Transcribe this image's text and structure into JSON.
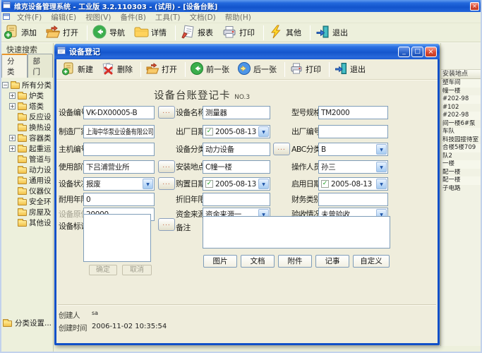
{
  "app": {
    "title": "维克设备管理系统 - 工业版 3.2.110303 - (试用) - [设备台账]",
    "menu_items": [
      "文件(F)",
      "编辑(E)",
      "视图(V)",
      "备件(B)",
      "工具(T)",
      "文档(D)",
      "帮助(H)"
    ],
    "toolbar": {
      "add": "添加",
      "open": "打开",
      "navigate": "导航",
      "details": "详情",
      "report": "报表",
      "print": "打印",
      "other": "其他",
      "exit": "退出"
    }
  },
  "sidebar": {
    "quick_search": "快速搜索",
    "tab_category": "分类",
    "tab_department": "部门",
    "tree": [
      {
        "label": "所有分类"
      },
      {
        "label": "炉类"
      },
      {
        "label": "塔类"
      },
      {
        "label": "反应设"
      },
      {
        "label": "换热设"
      },
      {
        "label": "容器类"
      },
      {
        "label": "起重运"
      },
      {
        "label": "管道与"
      },
      {
        "label": "动力设"
      },
      {
        "label": "通用设"
      },
      {
        "label": "仪器仪"
      },
      {
        "label": "安全环"
      },
      {
        "label": "房屋及"
      },
      {
        "label": "其他设"
      }
    ],
    "footer": "分类设置..."
  },
  "back_table": {
    "header": "安装地点",
    "rows": [
      "塑车间",
      "幢一楼",
      "#202-98",
      "#102",
      "#202-98",
      "间一楼6#泵",
      "车队",
      "科技园接待室",
      "合楼5楼709",
      "队2",
      "一楼",
      "配一楼",
      "配一楼",
      "子电路"
    ]
  },
  "dialog": {
    "title": "设备登记",
    "toolbar": {
      "new": "新建",
      "delete": "删除",
      "open": "打开",
      "prev": "前一张",
      "next": "后一张",
      "print": "打印",
      "exit": "退出"
    },
    "card_title": "设备台账登记卡",
    "card_no": "NO.3",
    "browse": "...",
    "fields": {
      "device_no": {
        "label": "设备编号",
        "value": "VK-DX00005-B"
      },
      "device_name": {
        "label": "设备名称",
        "value": "测量器"
      },
      "model": {
        "label": "型号规格",
        "value": "TM2000"
      },
      "manufacturer": {
        "label": "制造厂家",
        "value": "上海中华泵业设备有限公司"
      },
      "factory_date": {
        "label": "出厂日期",
        "value": "2005-08-13"
      },
      "factory_no": {
        "label": "出厂编号",
        "value": ""
      },
      "host_no": {
        "label": "主机编号",
        "value": ""
      },
      "category": {
        "label": "设备分类",
        "value": "动力设备"
      },
      "abc": {
        "label": "ABC分类",
        "value": "B"
      },
      "department": {
        "label": "使用部门",
        "value": "下吕浦营业所"
      },
      "location": {
        "label": "安装地点",
        "value": "C幢一楼"
      },
      "operator": {
        "label": "操作人员",
        "value": "孙三"
      },
      "status": {
        "label": "设备状况",
        "value": "报废"
      },
      "purchase_date": {
        "label": "购置日期",
        "value": "2005-08-13"
      },
      "enable_date": {
        "label": "启用日期",
        "value": "2005-08-13"
      },
      "service_life": {
        "label": "耐用年限",
        "value": "0"
      },
      "depreciation_life": {
        "label": "折旧年限",
        "value": ""
      },
      "finance_type": {
        "label": "财务类别",
        "value": ""
      },
      "original_value": {
        "label": "设备原值",
        "value": "20000"
      },
      "fund_source": {
        "label": "资金来源",
        "value": "资金来源一"
      },
      "acceptance": {
        "label": "验收情况",
        "value": "未曾验收"
      },
      "device_mark": {
        "label": "设备标识",
        "value": ""
      },
      "remark": {
        "label": "备注",
        "value": ""
      }
    },
    "buttons": {
      "ok": "确定",
      "cancel": "取消",
      "pic": "图片",
      "doc": "文档",
      "attach": "附件",
      "note": "记事",
      "custom": "自定义"
    },
    "footer": {
      "creator_label": "创建人",
      "creator_value": "sa",
      "created_label": "创建时间",
      "created_value": "2006-11-02 10:35:54"
    }
  },
  "colors": {
    "titlebar_blue": "#1556CC",
    "window_bg": "#EDF0DC",
    "form_bg": "#EFEDDC",
    "field_border": "#7F9DB9",
    "close_red": "#DC4A32",
    "tab_accent_orange": "#E8952C"
  }
}
